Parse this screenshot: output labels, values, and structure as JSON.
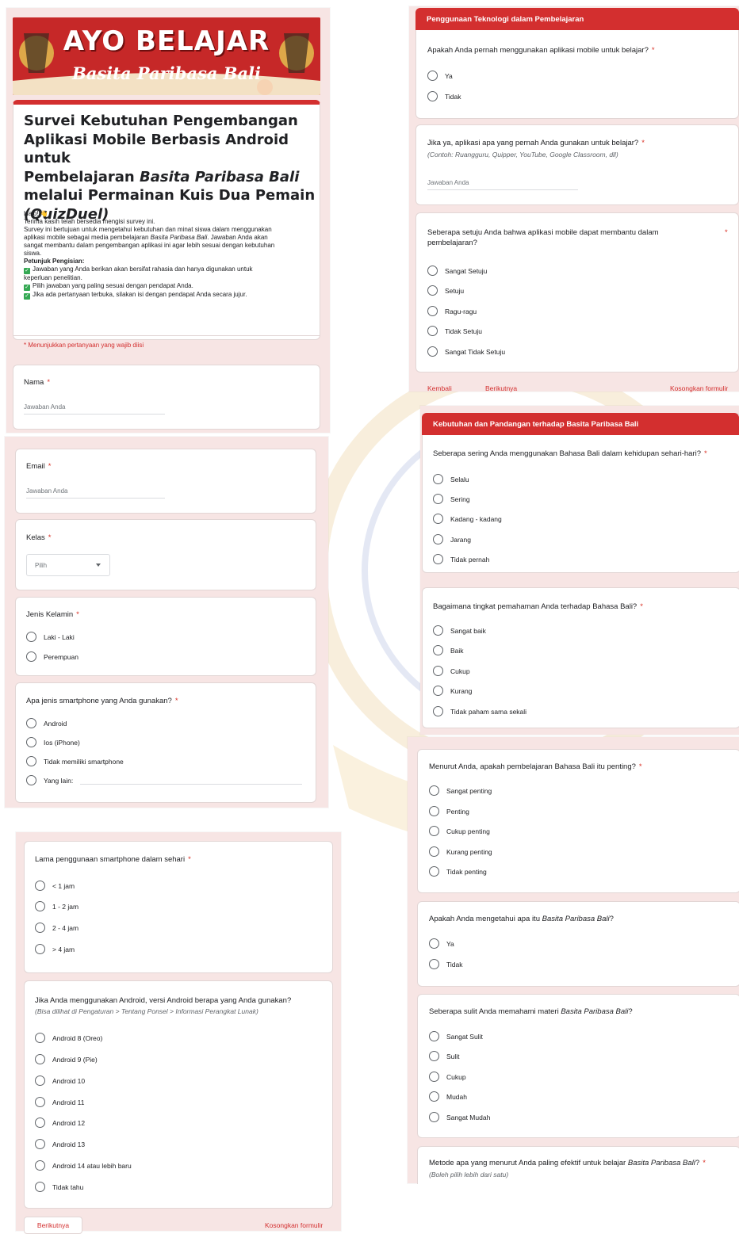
{
  "banner": {
    "title": "AYO BELAJAR",
    "subtitle": "Basita Paribasa Bali"
  },
  "intro": {
    "title_l1": "Survei Kebutuhan Pengembangan",
    "title_l2": "Aplikasi Mobile Berbasis Android untuk",
    "title_l3a": "Pembelajaran ",
    "title_l3b": "Basita Paribasa Bali",
    "title_l4": "melalui Permainan Kuis Dua Pemain",
    "title_l5": "(QuizDuel)",
    "greeting": "Halo! 👋",
    "p1": "Terima kasih telah bersedia mengisi survey ini.",
    "p2": "Survey ini bertujuan untuk mengetahui kebutuhan dan minat siswa dalam menggunakan",
    "p3a": "aplikasi mobile sebagai media pembelajaran ",
    "p3b": "Basita Paribasa Bali",
    ". Jawaban Anda akan": "",
    "p3c": ". Jawaban Anda akan",
    "p4": "sangat membantu dalam pengembangan aplikasi ini agar lebih sesuai dengan kebutuhan",
    "p5": "siswa.",
    "petunjuk": "Petunjuk Pengisian:",
    "b1a": "Jawaban yang Anda berikan akan bersifat rahasia dan hanya digunakan untuk",
    "b1b": "keperluan penelitian.",
    "b2": "Pilih jawaban yang paling sesuai dengan pendapat Anda.",
    "b3": "Jika ada pertanyaan terbuka, silakan isi dengan pendapat Anda secara jujur.",
    "required_note": "* Menunjukkan pertanyaan yang wajib diisi"
  },
  "common": {
    "req": "*",
    "answer_placeholder": "Jawaban Anda"
  },
  "nama": {
    "label": "Nama"
  },
  "email": {
    "label": "Email"
  },
  "kelas": {
    "label": "Kelas",
    "select": "Pilih"
  },
  "gender": {
    "label": "Jenis Kelamin",
    "options": [
      "Laki - Laki",
      "Perempuan"
    ]
  },
  "phone": {
    "label": "Apa jenis smartphone yang Anda gunakan?",
    "options": [
      "Android",
      "Ios (iPhone)",
      "Tidak memiliki smartphone",
      "Yang lain:"
    ]
  },
  "usage": {
    "label": "Lama penggunaan smartphone dalam sehari",
    "options": [
      "< 1 jam",
      "1 - 2 jam",
      "2 - 4 jam",
      "> 4 jam"
    ]
  },
  "android": {
    "label": "Jika Anda menggunakan Android, versi Android berapa yang Anda gunakan?",
    "hint": "(Bisa dilihat di Pengaturan > Tentang Ponsel > Informasi Perangkat Lunak)",
    "options": [
      "Android 8 (Oreo)",
      "Android 9 (Pie)",
      "Android 10",
      "Android 11",
      "Android 12",
      "Android 13",
      "Android 14 atau lebih baru",
      "Tidak tahu"
    ]
  },
  "nav": {
    "next": "Berikutnya",
    "back": "Kembali",
    "clear": "Kosongkan formulir"
  },
  "tech": {
    "header": "Penggunaan Teknologi dalam Pembelajaran",
    "q1": "Apakah Anda pernah menggunakan aplikasi mobile untuk belajar?",
    "q1_options": [
      "Ya",
      "Tidak"
    ],
    "q2": "Jika ya, aplikasi apa yang pernah Anda gunakan untuk belajar?",
    "q2_hint": "(Contoh: Ruangguru, Quipper, YouTube, Google Classroom, dll)",
    "q3a": "Seberapa setuju Anda bahwa aplikasi mobile dapat membantu dalam",
    "q3b": "pembelajaran?",
    "q3_options": [
      "Sangat Setuju",
      "Setuju",
      "Ragu-ragu",
      "Tidak Setuju",
      "Sangat Tidak Setuju"
    ]
  },
  "needs": {
    "header": "Kebutuhan dan Pandangan terhadap Basita Paribasa Bali",
    "q1": "Seberapa sering Anda menggunakan Bahasa Bali dalam kehidupan sehari-hari?",
    "q1_options": [
      "Selalu",
      "Sering",
      "Kadang - kadang",
      "Jarang",
      "Tidak pernah"
    ],
    "q2": "Bagaimana tingkat pemahaman Anda terhadap Bahasa Bali?",
    "q2_options": [
      "Sangat baik",
      "Baik",
      "Cukup",
      "Kurang",
      "Tidak paham sama sekali"
    ],
    "q3": "Menurut Anda, apakah pembelajaran Bahasa Bali itu penting?",
    "q3_options": [
      "Sangat penting",
      "Penting",
      "Cukup penting",
      "Kurang penting",
      "Tidak penting"
    ],
    "q4a": "Apakah Anda mengetahui apa itu ",
    "q4b": "Basita Paribasa Bali",
    "q4c": "?",
    "q4_options": [
      "Ya",
      "Tidak"
    ],
    "q5a": "Seberapa sulit Anda memahami materi ",
    "q5b": "Basita Paribasa Bali",
    "q5c": "?",
    "q5_options": [
      "Sangat Sulit",
      "Sulit",
      "Cukup",
      "Mudah",
      "Sangat Mudah"
    ],
    "q6a": "Metode apa yang menurut Anda paling efektif untuk belajar ",
    "q6b": "Basita Paribasa Bali",
    "q6c": "?",
    "q6_hint": "(Boleh pilih lebih dari satu)"
  }
}
